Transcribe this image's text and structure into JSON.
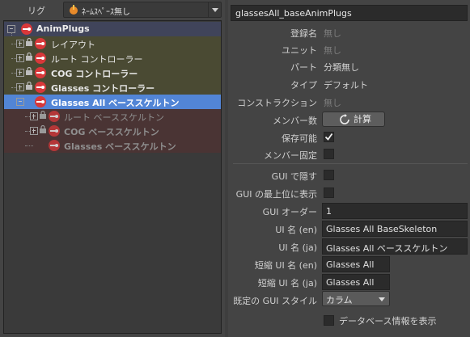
{
  "rig": {
    "label": "リグ",
    "value": "ﾈｰﾑｽﾍﾟｰｽ無し"
  },
  "tree": {
    "root": "AnimPlugs",
    "items": [
      {
        "label": "レイアウト"
      },
      {
        "label": "ルート コントローラー"
      },
      {
        "label": "COG コントローラー"
      },
      {
        "label": "Glasses コントローラー"
      },
      {
        "label": "Glasses All ベーススケルトン",
        "selected": true
      },
      {
        "label": "ルート ベーススケルトン"
      },
      {
        "label": "COG ベーススケルトン"
      },
      {
        "label": "Glasses ベーススケルトン"
      }
    ]
  },
  "props": {
    "title": "glassesAll_baseAnimPlugs",
    "registered_name_label": "登録名",
    "registered_name_value": "無し",
    "unit_label": "ユニット",
    "unit_value": "無し",
    "part_label": "パート",
    "part_value": "分類無し",
    "type_label": "タイプ",
    "type_value": "デフォルト",
    "construction_label": "コンストラクション",
    "construction_value": "無し",
    "member_count_label": "メンバー数",
    "calc_button": "計算",
    "savable_label": "保存可能",
    "member_fixed_label": "メンバー固定",
    "gui_hide_label": "GUI で隠す",
    "gui_top_label": "GUI の最上位に表示",
    "gui_order_label": "GUI オーダー",
    "gui_order_value": "1",
    "ui_name_en_label": "UI 名 (en)",
    "ui_name_en_value": "Glasses All BaseSkeleton",
    "ui_name_ja_label": "UI 名 (ja)",
    "ui_name_ja_value": "Glasses All ベーススケルトン",
    "short_ui_name_en_label": "短縮 UI 名 (en)",
    "short_ui_name_en_value": "Glasses All",
    "short_ui_name_ja_label": "短縮 UI 名 (ja)",
    "short_ui_name_ja_value": "Glasses All",
    "default_gui_style_label": "既定の GUI スタイル",
    "default_gui_style_value": "カラム",
    "show_db_info_label": "データベース情報を表示"
  },
  "colors": {
    "selected": "#5285d6",
    "row_olive": "#4a4a33",
    "row_red": "#4a3434",
    "root_bg": "#40445a",
    "plug_red": "#d8383a"
  }
}
